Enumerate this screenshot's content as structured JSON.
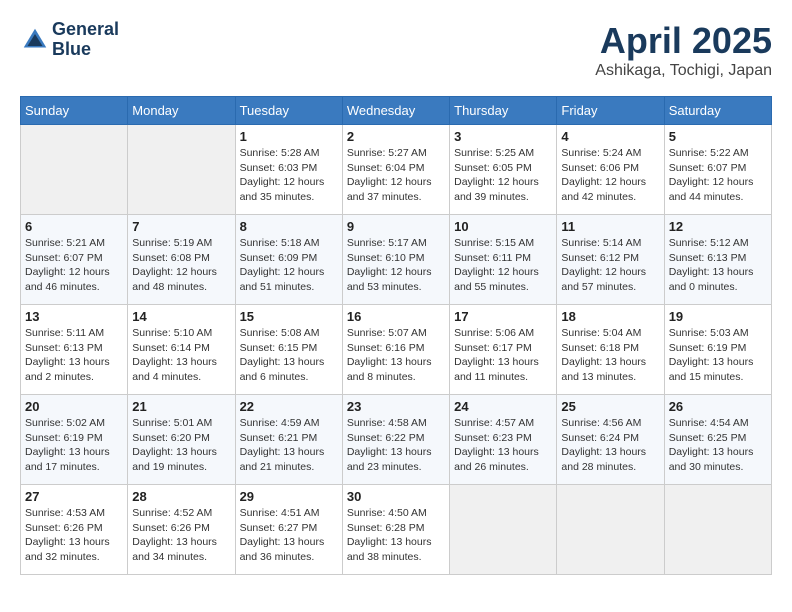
{
  "header": {
    "logo_line1": "General",
    "logo_line2": "Blue",
    "month": "April 2025",
    "location": "Ashikaga, Tochigi, Japan"
  },
  "weekdays": [
    "Sunday",
    "Monday",
    "Tuesday",
    "Wednesday",
    "Thursday",
    "Friday",
    "Saturday"
  ],
  "weeks": [
    [
      {
        "day": "",
        "info": ""
      },
      {
        "day": "",
        "info": ""
      },
      {
        "day": "1",
        "info": "Sunrise: 5:28 AM\nSunset: 6:03 PM\nDaylight: 12 hours and 35 minutes."
      },
      {
        "day": "2",
        "info": "Sunrise: 5:27 AM\nSunset: 6:04 PM\nDaylight: 12 hours and 37 minutes."
      },
      {
        "day": "3",
        "info": "Sunrise: 5:25 AM\nSunset: 6:05 PM\nDaylight: 12 hours and 39 minutes."
      },
      {
        "day": "4",
        "info": "Sunrise: 5:24 AM\nSunset: 6:06 PM\nDaylight: 12 hours and 42 minutes."
      },
      {
        "day": "5",
        "info": "Sunrise: 5:22 AM\nSunset: 6:07 PM\nDaylight: 12 hours and 44 minutes."
      }
    ],
    [
      {
        "day": "6",
        "info": "Sunrise: 5:21 AM\nSunset: 6:07 PM\nDaylight: 12 hours and 46 minutes."
      },
      {
        "day": "7",
        "info": "Sunrise: 5:19 AM\nSunset: 6:08 PM\nDaylight: 12 hours and 48 minutes."
      },
      {
        "day": "8",
        "info": "Sunrise: 5:18 AM\nSunset: 6:09 PM\nDaylight: 12 hours and 51 minutes."
      },
      {
        "day": "9",
        "info": "Sunrise: 5:17 AM\nSunset: 6:10 PM\nDaylight: 12 hours and 53 minutes."
      },
      {
        "day": "10",
        "info": "Sunrise: 5:15 AM\nSunset: 6:11 PM\nDaylight: 12 hours and 55 minutes."
      },
      {
        "day": "11",
        "info": "Sunrise: 5:14 AM\nSunset: 6:12 PM\nDaylight: 12 hours and 57 minutes."
      },
      {
        "day": "12",
        "info": "Sunrise: 5:12 AM\nSunset: 6:13 PM\nDaylight: 13 hours and 0 minutes."
      }
    ],
    [
      {
        "day": "13",
        "info": "Sunrise: 5:11 AM\nSunset: 6:13 PM\nDaylight: 13 hours and 2 minutes."
      },
      {
        "day": "14",
        "info": "Sunrise: 5:10 AM\nSunset: 6:14 PM\nDaylight: 13 hours and 4 minutes."
      },
      {
        "day": "15",
        "info": "Sunrise: 5:08 AM\nSunset: 6:15 PM\nDaylight: 13 hours and 6 minutes."
      },
      {
        "day": "16",
        "info": "Sunrise: 5:07 AM\nSunset: 6:16 PM\nDaylight: 13 hours and 8 minutes."
      },
      {
        "day": "17",
        "info": "Sunrise: 5:06 AM\nSunset: 6:17 PM\nDaylight: 13 hours and 11 minutes."
      },
      {
        "day": "18",
        "info": "Sunrise: 5:04 AM\nSunset: 6:18 PM\nDaylight: 13 hours and 13 minutes."
      },
      {
        "day": "19",
        "info": "Sunrise: 5:03 AM\nSunset: 6:19 PM\nDaylight: 13 hours and 15 minutes."
      }
    ],
    [
      {
        "day": "20",
        "info": "Sunrise: 5:02 AM\nSunset: 6:19 PM\nDaylight: 13 hours and 17 minutes."
      },
      {
        "day": "21",
        "info": "Sunrise: 5:01 AM\nSunset: 6:20 PM\nDaylight: 13 hours and 19 minutes."
      },
      {
        "day": "22",
        "info": "Sunrise: 4:59 AM\nSunset: 6:21 PM\nDaylight: 13 hours and 21 minutes."
      },
      {
        "day": "23",
        "info": "Sunrise: 4:58 AM\nSunset: 6:22 PM\nDaylight: 13 hours and 23 minutes."
      },
      {
        "day": "24",
        "info": "Sunrise: 4:57 AM\nSunset: 6:23 PM\nDaylight: 13 hours and 26 minutes."
      },
      {
        "day": "25",
        "info": "Sunrise: 4:56 AM\nSunset: 6:24 PM\nDaylight: 13 hours and 28 minutes."
      },
      {
        "day": "26",
        "info": "Sunrise: 4:54 AM\nSunset: 6:25 PM\nDaylight: 13 hours and 30 minutes."
      }
    ],
    [
      {
        "day": "27",
        "info": "Sunrise: 4:53 AM\nSunset: 6:26 PM\nDaylight: 13 hours and 32 minutes."
      },
      {
        "day": "28",
        "info": "Sunrise: 4:52 AM\nSunset: 6:26 PM\nDaylight: 13 hours and 34 minutes."
      },
      {
        "day": "29",
        "info": "Sunrise: 4:51 AM\nSunset: 6:27 PM\nDaylight: 13 hours and 36 minutes."
      },
      {
        "day": "30",
        "info": "Sunrise: 4:50 AM\nSunset: 6:28 PM\nDaylight: 13 hours and 38 minutes."
      },
      {
        "day": "",
        "info": ""
      },
      {
        "day": "",
        "info": ""
      },
      {
        "day": "",
        "info": ""
      }
    ]
  ]
}
